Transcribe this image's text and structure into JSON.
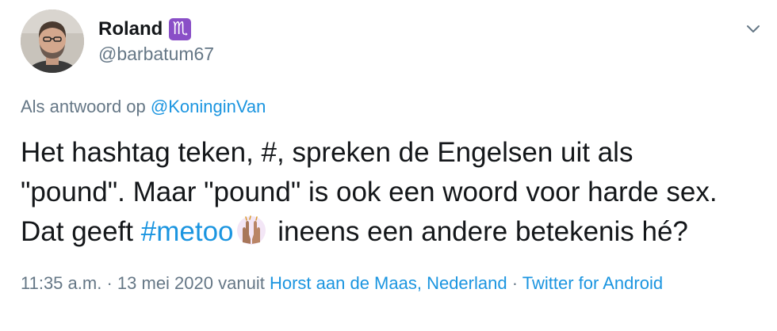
{
  "author": {
    "display_name": "Roland",
    "badge_symbol": "♏",
    "badge_color": "#8a4fc7",
    "handle": "@barbatum67",
    "avatar_icon": "profile-photo"
  },
  "reply": {
    "prefix": "Als antwoord op",
    "mention": "@KoninginVan"
  },
  "tweet": {
    "line1": "Het hashtag teken, #, spreken de Engelsen uit als",
    "line2": "\"pound\". Maar \"pound\" is ook een woord voor harde sex.",
    "line3_before": "Dat geeft",
    "hashtag": "#metoo",
    "emoji_icon": "raised-hands-emoji",
    "line3_after": "ineens een andere betekenis hé?"
  },
  "meta": {
    "time": "11:35 a.m.",
    "sep1": "·",
    "date": "13 mei 2020",
    "via": "vanuit",
    "location": "Horst aan de Maas, Nederland",
    "sep2": "·",
    "source": "Twitter for Android"
  },
  "colors": {
    "text": "#14171a",
    "secondary": "#657786",
    "link": "#1b95e0"
  }
}
